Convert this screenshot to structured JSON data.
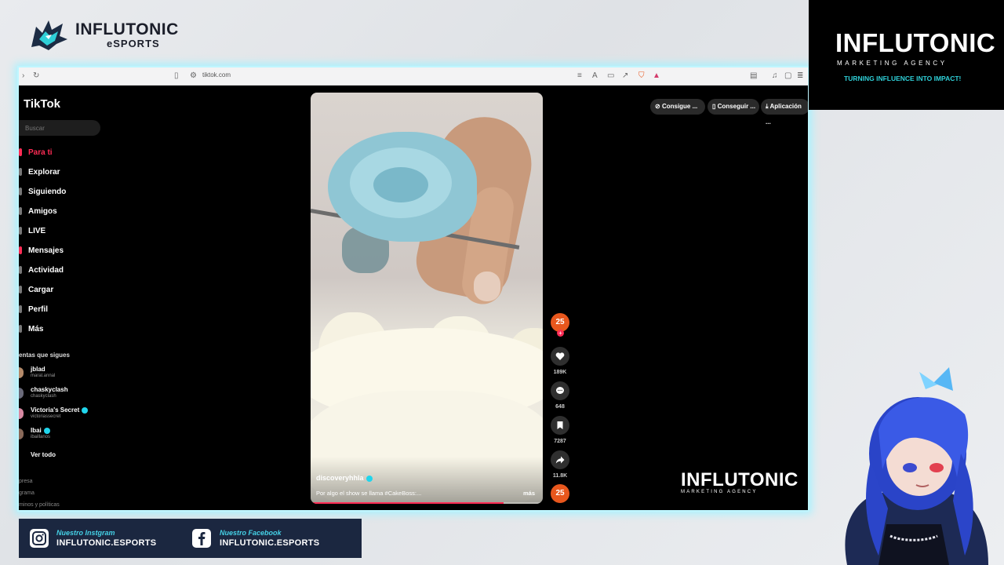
{
  "overlay": {
    "top_logo": {
      "line1": "INFLUTONIC",
      "line2": "eSPORTS"
    },
    "right_panel": {
      "title": "INFLUTONIC",
      "subtitle": "MARKETING AGENCY",
      "tagline": "TURNING INFLUENCE INTO IMPACT!"
    },
    "watermark": {
      "title": "INFLUTONIC",
      "subtitle": "MARKETING AGENCY"
    },
    "social": [
      {
        "caption": "Nuestro Instgram",
        "handle": "INFLUTONIC.ESPORTS",
        "icon": "instagram-icon"
      },
      {
        "caption": "Nuestro Facebook",
        "handle": "INFLUTONIC.ESPORTS",
        "icon": "facebook-icon"
      }
    ],
    "colors": {
      "accent": "#2fd0d8",
      "frame_glow": "#a8f2ff",
      "tiktok_red": "#fe2c55",
      "social_bar": "#1b2740"
    }
  },
  "browser": {
    "url": "tiktok.com"
  },
  "tiktok": {
    "logo": "TikTok",
    "search_placeholder": "Buscar",
    "nav": [
      {
        "label": "Para ti",
        "active": true
      },
      {
        "label": "Explorar"
      },
      {
        "label": "Siguiendo"
      },
      {
        "label": "Amigos"
      },
      {
        "label": "LIVE"
      },
      {
        "label": "Mensajes"
      },
      {
        "label": "Actividad"
      },
      {
        "label": "Cargar"
      },
      {
        "label": "Perfil"
      },
      {
        "label": "Más"
      }
    ],
    "following_title": "entas que sigues",
    "following": [
      {
        "name": "jblad",
        "handle": "maral.annal",
        "verified": false
      },
      {
        "name": "chaskyclash",
        "handle": "chaskyclash",
        "verified": false
      },
      {
        "name": "Victoria's Secret",
        "handle": "victoriassecret",
        "verified": true
      },
      {
        "name": "Ibai",
        "handle": "ibaillanos",
        "verified": true
      }
    ],
    "see_all": "Ver todo",
    "footer": [
      "presa",
      "grama",
      "minos y políticas"
    ],
    "top_buttons": [
      "Consigue ...",
      "Conseguir ...",
      "Aplicación ..."
    ],
    "video": {
      "author": "discoveryhhla",
      "description": "Por algo el show se llama #CakeBoss:...",
      "more": "más",
      "progress": 0.83
    },
    "actions": {
      "avatar_label": "25",
      "likes": "189K",
      "comments": "648",
      "saves": "7287",
      "shares": "11.8K",
      "sound_label": "25"
    }
  }
}
